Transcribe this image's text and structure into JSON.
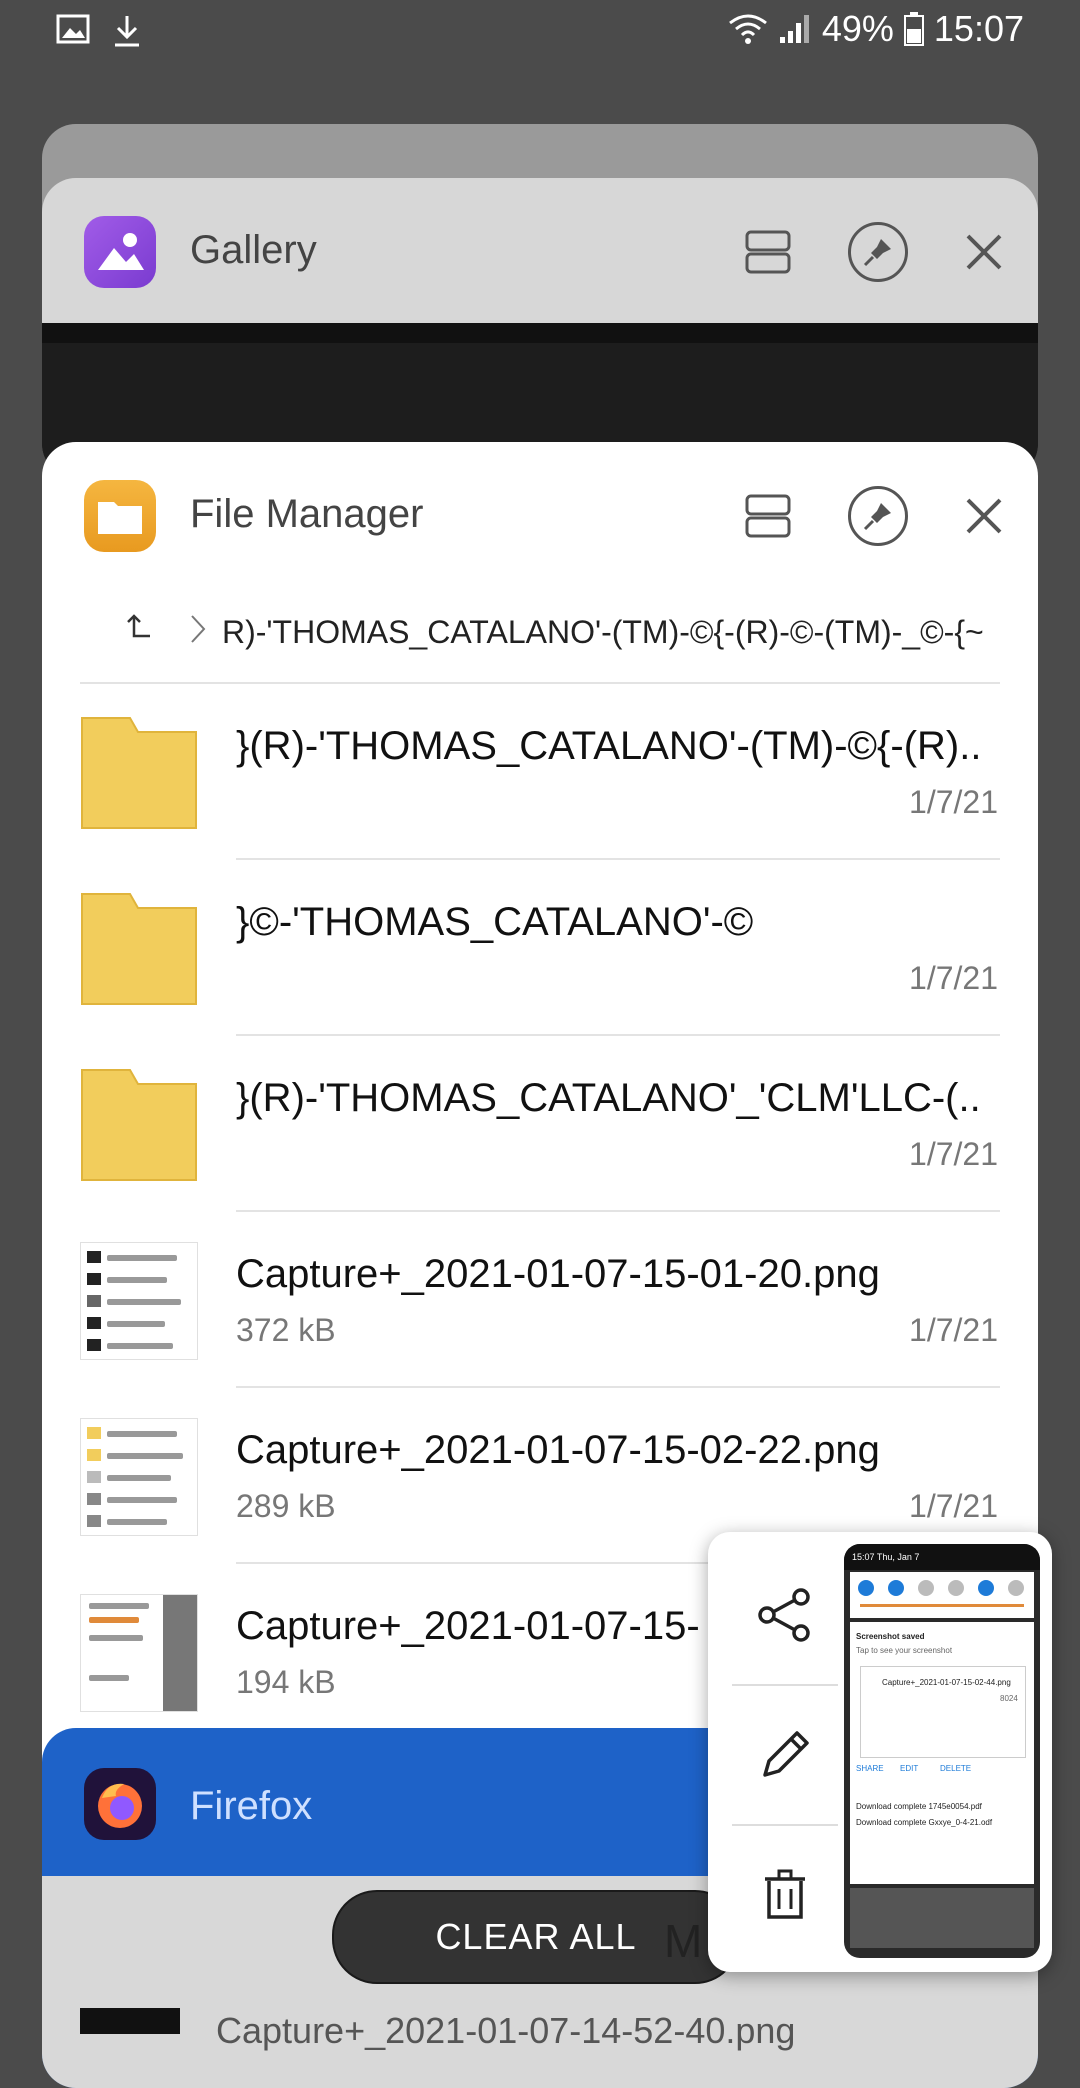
{
  "status_bar": {
    "battery": "49%",
    "time": "15:07",
    "left_icons": [
      "image-icon",
      "download-icon"
    ],
    "right_icons": [
      "wifi-icon",
      "signal-icon",
      "battery-icon"
    ]
  },
  "gallery_card": {
    "title": "Gallery"
  },
  "file_manager_card": {
    "title": "File Manager",
    "breadcrumb_path": "R)-'THOMAS_CATALANO'-(TM)-©{-(R)-©-(TM)-_©-{~",
    "items": [
      {
        "type": "folder",
        "name": "}(R)-'THOMAS_CATALANO'-(TM)-©{-(R)..",
        "size": "",
        "date": "1/7/21"
      },
      {
        "type": "folder",
        "name": "}©-'THOMAS_CATALANO'-©",
        "size": "",
        "date": "1/7/21"
      },
      {
        "type": "folder",
        "name": "}(R)-'THOMAS_CATALANO'_'CLM'LLC-(..",
        "size": "",
        "date": "1/7/21"
      },
      {
        "type": "image",
        "name": "Capture+_2021-01-07-15-01-20.png",
        "size": "372 kB",
        "date": "1/7/21"
      },
      {
        "type": "image",
        "name": "Capture+_2021-01-07-15-02-22.png",
        "size": "289 kB",
        "date": "1/7/21"
      },
      {
        "type": "image",
        "name": "Capture+_2021-01-07-15-",
        "size": "194 kB",
        "date": ""
      }
    ]
  },
  "firefox_card": {
    "title": "Firefox"
  },
  "clear_all_label": "CLEAR ALL",
  "partial_letter": "M",
  "bottom_partial_text": "Capture+_2021-01-07-14-52-40.png",
  "screenshot_preview": {
    "time": "15:07 Thu, Jan 7",
    "notif_title": "Screenshot saved",
    "notif_sub": "Tap to see your screenshot",
    "file_line": "Capture+_2021-01-07-15-02-44.png",
    "size_line": "8024",
    "action_share": "SHARE",
    "action_edit": "EDIT",
    "action_delete": "DELETE",
    "dl1": "Download complete 1745e0054.pdf",
    "dl2": "Download complete Gxxye_0-4-21.odf"
  },
  "colors": {
    "firefox_blue": "#1e62c8",
    "folder_yellow": "#f2cd5c",
    "gallery_purple": "#8b4bd8",
    "file_manager_orange": "#f0a830"
  }
}
